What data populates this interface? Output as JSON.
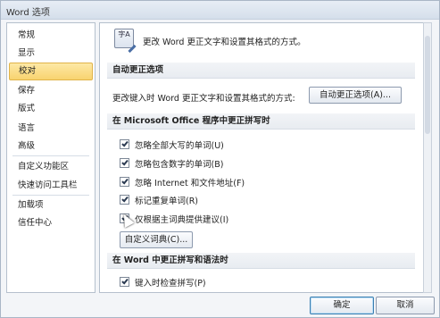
{
  "window": {
    "title": "Word 选项"
  },
  "sidebar": {
    "items": [
      {
        "label": "常规"
      },
      {
        "label": "显示"
      },
      {
        "label": "校对"
      },
      {
        "label": "保存"
      },
      {
        "label": "版式"
      },
      {
        "label": "语言"
      },
      {
        "label": "高级"
      },
      {
        "label": "自定义功能区"
      },
      {
        "label": "快速访问工具栏"
      },
      {
        "label": "加载项"
      },
      {
        "label": "信任中心"
      }
    ],
    "selected": "校对"
  },
  "content": {
    "header_icon_text": "字A",
    "header_text": "更改 Word 更正文字和设置其格式的方式。",
    "autocorrect": {
      "section_title": "自动更正选项",
      "description": "更改键入时 Word 更正文字和设置其格式的方式:",
      "button_label": "自动更正选项(A)..."
    },
    "office_spelling": {
      "section_title": "在 Microsoft Office 程序中更正拼写时",
      "options": [
        {
          "label": "忽略全部大写的单词(U)",
          "checked": true
        },
        {
          "label": "忽略包含数字的单词(B)",
          "checked": true
        },
        {
          "label": "忽略 Internet 和文件地址(F)",
          "checked": true
        },
        {
          "label": "标记重复单词(R)",
          "checked": true
        },
        {
          "label": "仅根据主词典提供建议(I)",
          "checked": true
        }
      ],
      "custom_dict_button": "自定义词典(C)..."
    },
    "word_spelling": {
      "section_title": "在 Word 中更正拼写和语法时",
      "options": [
        {
          "label": "键入时检查拼写(P)",
          "checked": true
        }
      ]
    }
  },
  "footer": {
    "ok_label": "确定",
    "cancel_label": "取消"
  }
}
